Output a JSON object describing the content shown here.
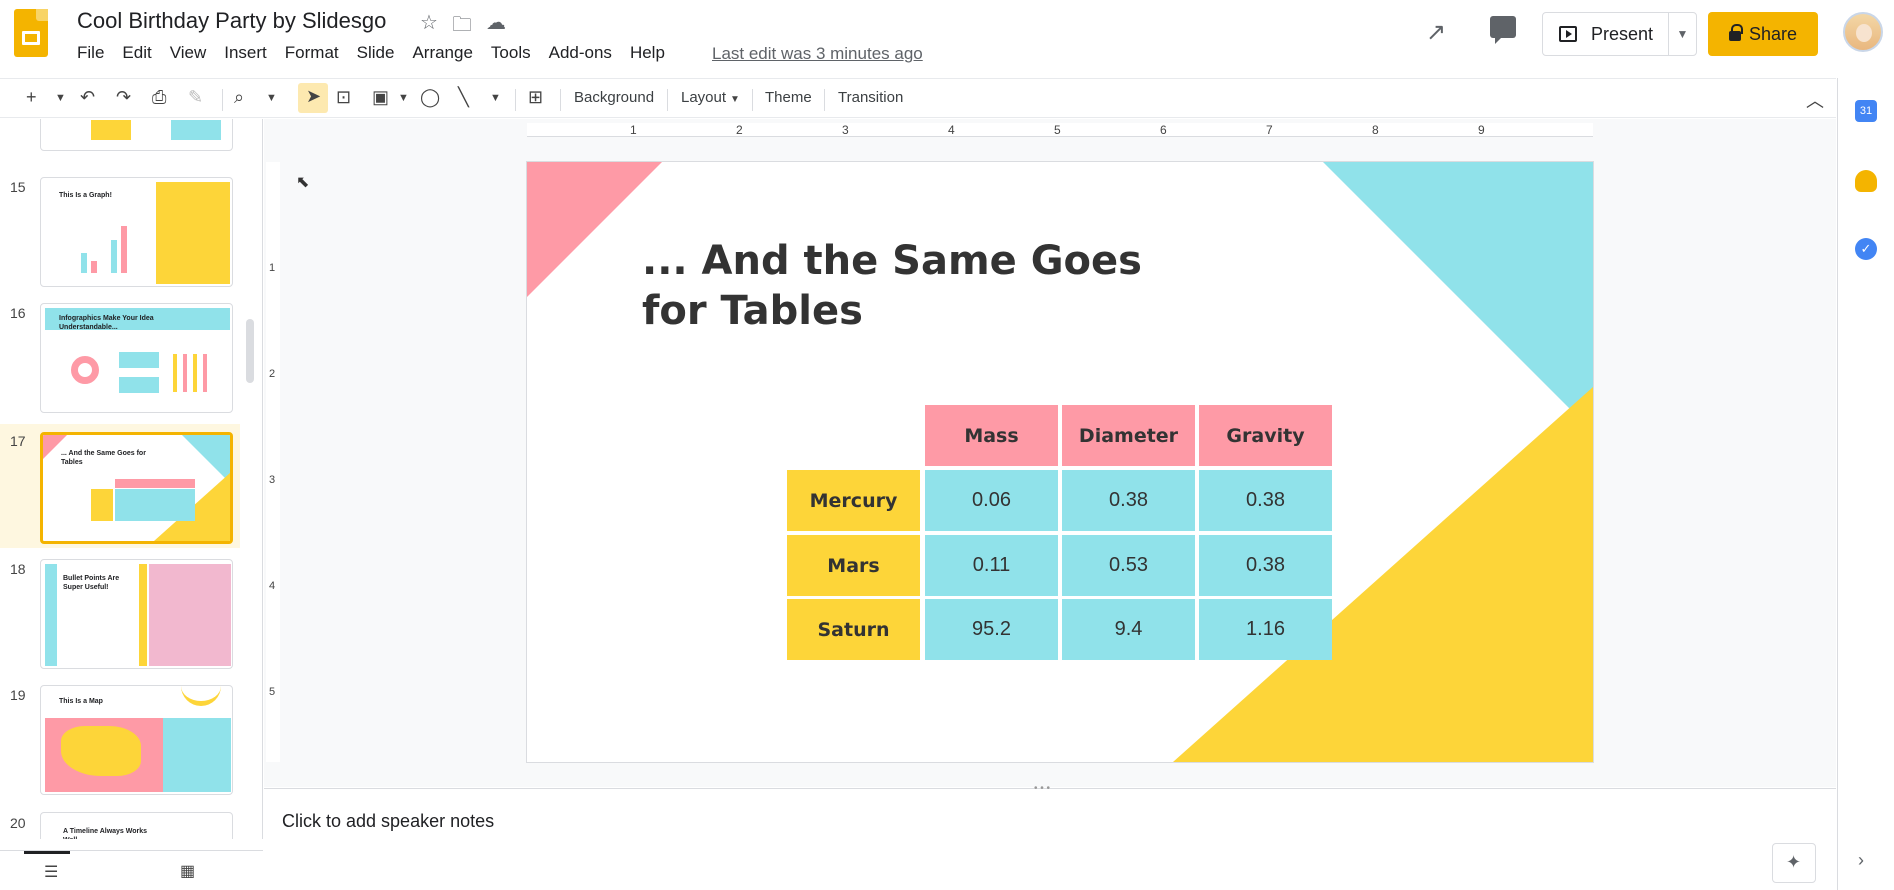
{
  "header": {
    "title": "Cool Birthday Party by Slidesgo",
    "menu": [
      "File",
      "Edit",
      "View",
      "Insert",
      "Format",
      "Slide",
      "Arrange",
      "Tools",
      "Add-ons",
      "Help"
    ],
    "last_edit": "Last edit was 3 minutes ago",
    "present_label": "Present",
    "share_label": "Share"
  },
  "toolbar": {
    "background_label": "Background",
    "layout_label": "Layout",
    "theme_label": "Theme",
    "transition_label": "Transition"
  },
  "ruler": {
    "top": [
      "1",
      "2",
      "3",
      "4",
      "5",
      "6",
      "7",
      "8",
      "9"
    ],
    "left": [
      "1",
      "2",
      "3",
      "4",
      "5"
    ]
  },
  "filmstrip": {
    "slides": [
      {
        "num": "15",
        "title": "This Is a Graph!"
      },
      {
        "num": "16",
        "title": "Infographics Make Your Idea Understandable..."
      },
      {
        "num": "17",
        "title": "... And the Same Goes for Tables"
      },
      {
        "num": "18",
        "title": "Bullet Points Are Super Useful!"
      },
      {
        "num": "19",
        "title": "This Is a Map"
      },
      {
        "num": "20",
        "title": "A Timeline Always Works Well"
      }
    ]
  },
  "slide": {
    "title": "... And the Same Goes for Tables",
    "table": {
      "headers": [
        "Mass",
        "Diameter",
        "Gravity"
      ],
      "rows": [
        {
          "label": "Mercury",
          "values": [
            "0.06",
            "0.38",
            "0.38"
          ]
        },
        {
          "label": "Mars",
          "values": [
            "0.11",
            "0.53",
            "0.38"
          ]
        },
        {
          "label": "Saturn",
          "values": [
            "95.2",
            "9.4",
            "1.16"
          ]
        }
      ]
    }
  },
  "notes": {
    "placeholder": "Click to add speaker notes"
  },
  "colors": {
    "brand_yellow": "#f4b400",
    "slide_pink": "#fe9aa6",
    "slide_teal": "#90e2ea",
    "slide_yellow": "#fdd539"
  }
}
